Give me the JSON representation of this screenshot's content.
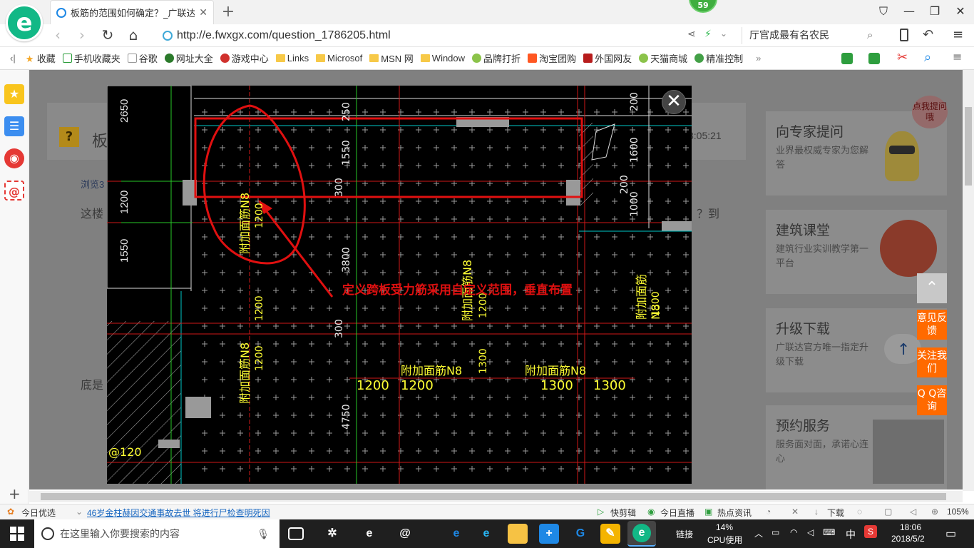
{
  "browser": {
    "tab_title": "板筋的范围如何确定？_广联达服",
    "badge_count": "59",
    "url": "http://e.fwxgx.com/question_1786205.html",
    "search_text": "厅官成最有名农民"
  },
  "bookmarks": [
    {
      "label": "收藏",
      "icon": "star-icon"
    },
    {
      "label": "手机收藏夹",
      "icon": "phone-icon"
    },
    {
      "label": "谷歌",
      "icon": "page-icon"
    },
    {
      "label": "网址大全",
      "icon": "globe-icon"
    },
    {
      "label": "游戏中心",
      "icon": "game-icon"
    },
    {
      "label": "Links",
      "icon": "folder-icon"
    },
    {
      "label": "Microsof",
      "icon": "folder-icon"
    },
    {
      "label": "MSN 网",
      "icon": "folder-icon"
    },
    {
      "label": "Window",
      "icon": "folder-icon"
    },
    {
      "label": "品牌打折",
      "icon": "leaf-icon"
    },
    {
      "label": "淘宝团购",
      "icon": "taobao-icon"
    },
    {
      "label": "外国网友",
      "icon": "flag-icon"
    },
    {
      "label": "天猫商城",
      "icon": "leaf-icon"
    },
    {
      "label": "精准控制",
      "icon": "chat-icon"
    }
  ],
  "page": {
    "question_title_fragment": "板",
    "time_fragment": "3:05:21",
    "views_fragment": "浏览3",
    "body_fragment": "这楼",
    "body_fragment_right": "？到",
    "body_fragment_lower": "底是"
  },
  "side_cards": [
    {
      "title": "向专家提问",
      "sub": "业界最权威专家为您解答"
    },
    {
      "title": "建筑课堂",
      "sub": "建筑行业实训教学第一平台"
    },
    {
      "title": "升级下载",
      "sub": "广联达官方唯一指定升级下载"
    },
    {
      "title": "预约服务",
      "sub": "服务面对面，承诺心连心"
    }
  ],
  "mascot_bubble": "点我提问哦",
  "float_buttons": {
    "feedback": "意见反馈",
    "follow": "关注我们",
    "qq": "Q Q咨询"
  },
  "cad": {
    "annotation": "定义跨板受力筋采用自定义范围，垂直布置",
    "dims_vertical_left": [
      "2650",
      "1200",
      "1550"
    ],
    "dims_top": [
      "250",
      "1550",
      "300",
      "3800",
      "300",
      "4750"
    ],
    "dims_right": [
      "200",
      "1600",
      "200",
      "1000"
    ],
    "rebar_label": "附加面筋N8",
    "row_dims": [
      "1200",
      "1200",
      "1300",
      "1300"
    ],
    "col_dims": [
      "1200",
      "1200",
      "1300",
      "1200",
      "1200",
      "1300"
    ],
    "corner_label": "@120"
  },
  "statusbar": {
    "today_pick": "今日优选",
    "news": "46岁金柱赫因交通事故去世 将进行尸检查明死因",
    "items": [
      "快剪辑",
      "今日直播",
      "热点资讯",
      "下载"
    ],
    "zoom": "105%"
  },
  "taskbar": {
    "search_placeholder": "在这里输入你要搜索的内容",
    "link_label": "链接",
    "cpu_pct": "14%",
    "cpu_label": "CPU使用",
    "ime": "中",
    "time": "18:06",
    "date": "2018/5/2"
  }
}
